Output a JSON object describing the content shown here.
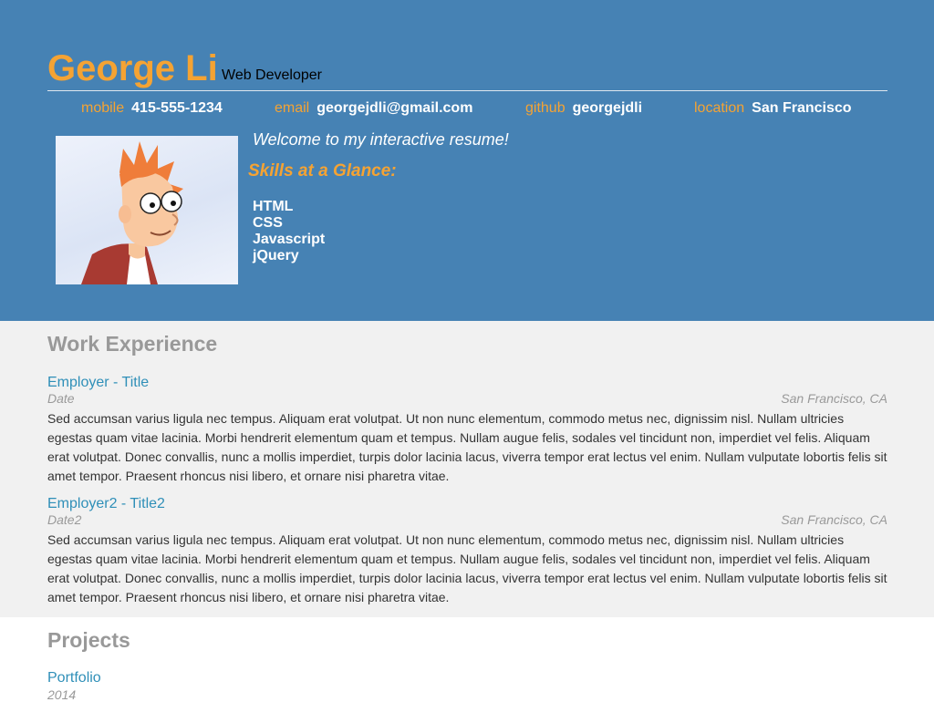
{
  "header": {
    "name": "George Li",
    "role": "Web Developer",
    "contacts": {
      "mobile": {
        "label": "mobile",
        "value": "415-555-1234"
      },
      "email": {
        "label": "email",
        "value": "georgejdli@gmail.com"
      },
      "github": {
        "label": "github",
        "value": "georgejdli"
      },
      "location": {
        "label": "location",
        "value": "San Francisco"
      }
    },
    "photo_icon": "cartoon-avatar-icon",
    "welcome": "Welcome to my interactive resume!",
    "skills_title": "Skills at a Glance:",
    "skills": [
      "HTML",
      "CSS",
      "Javascript",
      "jQuery"
    ]
  },
  "work": {
    "title": "Work Experience",
    "entries": [
      {
        "title": "Employer - Title",
        "date": "Date",
        "location": "San Francisco, CA",
        "description": "Sed accumsan varius ligula nec tempus. Aliquam erat volutpat. Ut non nunc elementum, commodo metus nec, dignissim nisl. Nullam ultricies egestas quam vitae lacinia. Morbi hendrerit elementum quam et tempus. Nullam augue felis, sodales vel tincidunt non, imperdiet vel felis. Aliquam erat volutpat. Donec convallis, nunc a mollis imperdiet, turpis dolor lacinia lacus, viverra tempor erat lectus vel enim. Nullam vulputate lobortis felis sit amet tempor. Praesent rhoncus nisi libero, et ornare nisi pharetra vitae."
      },
      {
        "title": "Employer2 - Title2",
        "date": "Date2",
        "location": "San Francisco, CA",
        "description": "Sed accumsan varius ligula nec tempus. Aliquam erat volutpat. Ut non nunc elementum, commodo metus nec, dignissim nisl. Nullam ultricies egestas quam vitae lacinia. Morbi hendrerit elementum quam et tempus. Nullam augue felis, sodales vel tincidunt non, imperdiet vel felis. Aliquam erat volutpat. Donec convallis, nunc a mollis imperdiet, turpis dolor lacinia lacus, viverra tempor erat lectus vel enim. Nullam vulputate lobortis felis sit amet tempor. Praesent rhoncus nisi libero, et ornare nisi pharetra vitae."
      }
    ]
  },
  "projects": {
    "title": "Projects",
    "entries": [
      {
        "title": "Portfolio",
        "date": "2014"
      }
    ]
  },
  "colors": {
    "header_bg": "#4682b4",
    "accent_orange": "#f5a333",
    "link_blue": "#2f8fb8",
    "muted_gray": "#999999",
    "section_bg": "#f1f1f1"
  }
}
